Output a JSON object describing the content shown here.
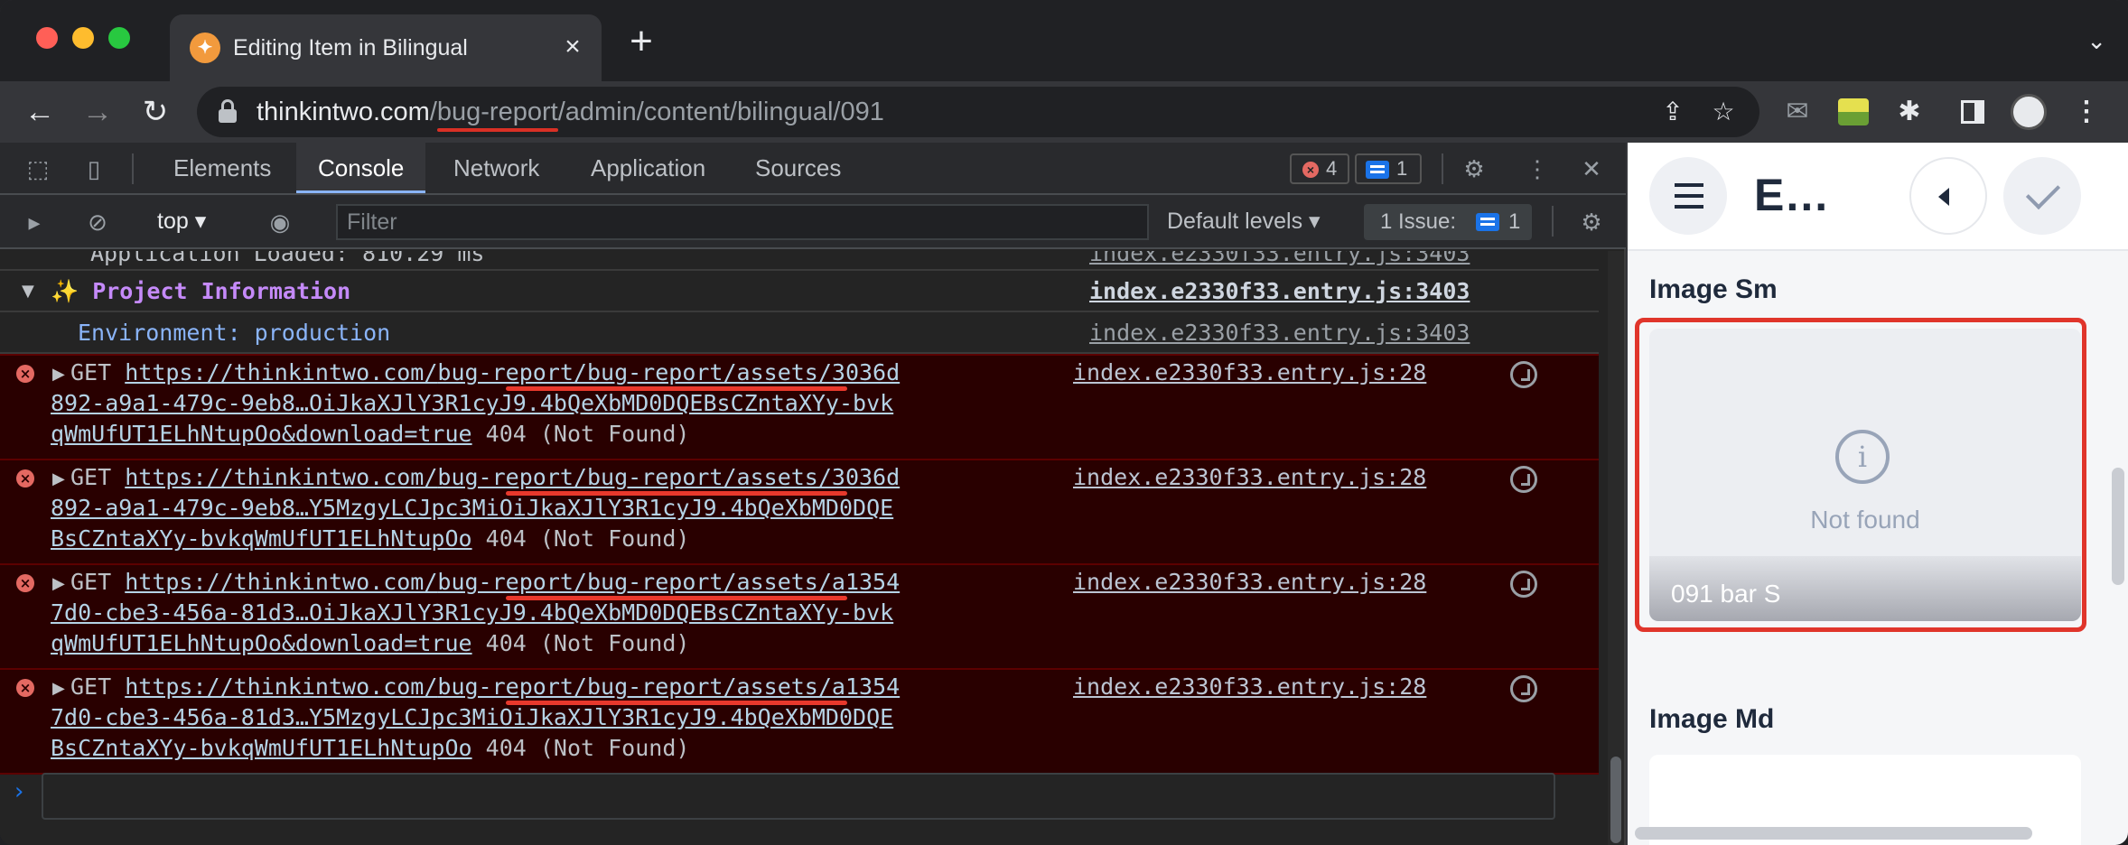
{
  "browser": {
    "tab_title": "Editing Item in Bilingual",
    "url_host": "thinkintwo.com",
    "url_slash": "/",
    "url_highlight": "bug-report",
    "url_rest": "/admin/content/bilingual/091"
  },
  "devtools": {
    "tabs": [
      "Elements",
      "Console",
      "Network",
      "Application",
      "Sources"
    ],
    "active_tab": "Console",
    "error_count": "4",
    "message_count": "1",
    "context": "top",
    "filter_placeholder": "Filter",
    "levels": "Default levels",
    "issues_label": "1 Issue:",
    "issues_count": "1",
    "log": {
      "partial_line": "Application Loaded: 810.29 ms",
      "partial_source": "index.e2330f33.entry.js:3403",
      "group_title": "Project Information",
      "group_source": "index.e2330f33.entry.js:3403",
      "env_line": "Environment: production",
      "env_source": "index.e2330f33.entry.js:3403"
    },
    "errors": [
      {
        "method": "GET",
        "prefix": "https://thinkintwo.com/",
        "hl": "bug-report/bug-report",
        "line1_rest": "/assets/3036d",
        "line2": "892-a9a1-479c-9eb8…OiJkaXJlY3R1cyJ9.4bQeXbMD0DQEBsCZntaXYy-bvk",
        "line3_link": "qWmUfUT1ELhNtupOo&download=true",
        "status": "404 (Not Found)",
        "source": "index.e2330f33.entry.js:28"
      },
      {
        "method": "GET",
        "prefix": "https://thinkintwo.com/",
        "hl": "bug-report/bug-report",
        "line1_rest": "/assets/3036d",
        "line2": "892-a9a1-479c-9eb8…Y5MzgyLCJpc3MiOiJkaXJlY3R1cyJ9.4bQeXbMD0DQE",
        "line3_link": "BsCZntaXYy-bvkqWmUfUT1ELhNtupOo",
        "status": "404 (Not Found)",
        "source": "index.e2330f33.entry.js:28"
      },
      {
        "method": "GET",
        "prefix": "https://thinkintwo.com/",
        "hl": "bug-report/bug-report",
        "line1_rest": "/assets/a1354",
        "line2": "7d0-cbe3-456a-81d3…OiJkaXJlY3R1cyJ9.4bQeXbMD0DQEBsCZntaXYy-bvk",
        "line3_link": "qWmUfUT1ELhNtupOo&download=true",
        "status": "404 (Not Found)",
        "source": "index.e2330f33.entry.js:28"
      },
      {
        "method": "GET",
        "prefix": "https://thinkintwo.com/",
        "hl": "bug-report/bug-report",
        "line1_rest": "/assets/a1354",
        "line2": "7d0-cbe3-456a-81d3…Y5MzgyLCJpc3MiOiJkaXJlY3R1cyJ9.4bQeXbMD0DQE",
        "line3_link": "BsCZntaXYy-bvkqWmUfUT1ELhNtupOo",
        "status": "404 (Not Found)",
        "source": "index.e2330f33.entry.js:28"
      }
    ]
  },
  "page": {
    "title": "E…",
    "section_sm": "Image Sm",
    "not_found": "Not found",
    "caption": "091 bar S",
    "section_md": "Image Md"
  },
  "colors": {
    "accent": "#8ab4f8",
    "error_bg": "#290000",
    "highlight": "#e8382c"
  }
}
